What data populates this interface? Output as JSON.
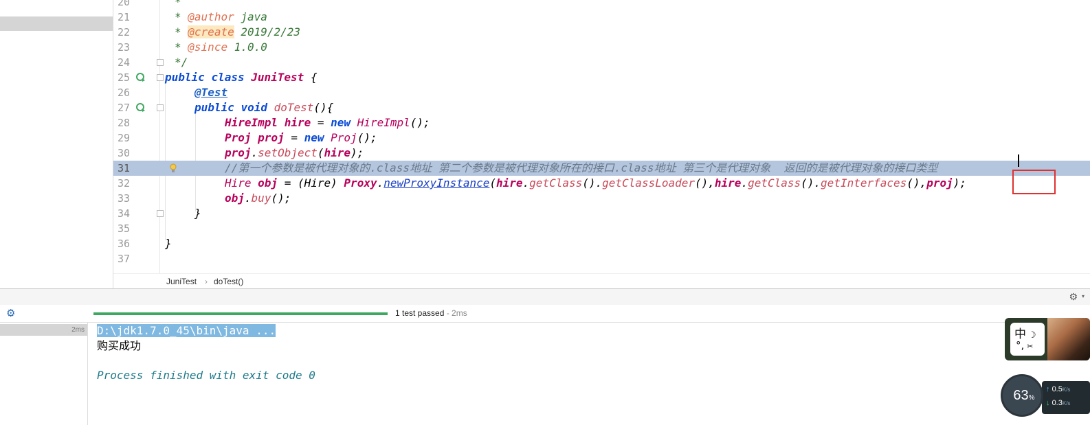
{
  "editor": {
    "lines": [
      {
        "num": "20"
      },
      {
        "num": "21"
      },
      {
        "num": "22"
      },
      {
        "num": "23"
      },
      {
        "num": "24"
      },
      {
        "num": "25"
      },
      {
        "num": "26"
      },
      {
        "num": "27"
      },
      {
        "num": "28"
      },
      {
        "num": "29"
      },
      {
        "num": "30"
      },
      {
        "num": "31"
      },
      {
        "num": "32"
      },
      {
        "num": "33"
      },
      {
        "num": "34"
      },
      {
        "num": "35"
      },
      {
        "num": "36"
      },
      {
        "num": "37"
      }
    ],
    "doc": {
      "star": "*",
      "author_tag": "@author",
      "author_val": " java",
      "create_tag": "@create",
      "create_val": " 2019/2/23",
      "since_tag": "@since",
      "since_val": " 1.0.0",
      "end": "*/"
    },
    "code": {
      "public": "public",
      "class": "class",
      "class_name": "JuniTest",
      "open_brace": " {",
      "test_ann": "@Test",
      "void": "void",
      "method_name": "doTest",
      "method_sig": "(){",
      "hire_type": "HireImpl",
      "hire_var": "hire",
      "eq": " = ",
      "new": "new",
      "hire_ctor": "HireImpl",
      "paren_end": "();",
      "proj_type": "Proj",
      "proj_var": "proj",
      "proj_ctor": "Proj",
      "set_object": "setObject",
      "set_args_open": "(",
      "set_args_close": ");",
      "comment": "//第一个参数是被代理对象的.class地址 第二个参数是被代理对象所在的接口.class地址 第三个是代理对象  返回的是被代理对象的接口类型",
      "hire_iface": "Hire",
      "obj_var": "obj",
      "cast": "(Hire)",
      "proxy": "Proxy",
      "dot": ".",
      "new_proxy": "newProxyInstance",
      "open_paren": "(",
      "get_class": "getClass",
      "get_loader": "getClassLoader",
      "get_ifaces": "getInterfaces",
      "call": "()",
      "comma": ",",
      "close_stmt": ");",
      "buy": "buy",
      "close_brace": "}"
    }
  },
  "breadcrumb": {
    "class": "JuniTest",
    "sep": "›",
    "method": "doTest()"
  },
  "run": {
    "status_main": "1 test passed",
    "status_dur": " - 2ms",
    "tree_time": "2ms",
    "progress": 1.0
  },
  "console": {
    "cmd": "D:\\jdk1.7.0_45\\bin\\java ...",
    "output": "购买成功",
    "finished": "Process finished with exit code 0"
  },
  "ime": {
    "char": "中",
    "moon": "☽",
    "punct": "°,",
    "butterfly": "✂"
  },
  "net": {
    "percent": "63",
    "percent_sign": "%",
    "up": "0.5",
    "up_unit": "K/s",
    "down": "0.3",
    "down_unit": "K/s",
    "up_arrow": "↑",
    "down_arrow": "↓"
  },
  "icons": {
    "settings": "⚙"
  },
  "colors": {
    "keyword": "#0a4bd6",
    "class": "#b8005a",
    "doc": "#3a7a3a",
    "highlight_line": "#b4c5de",
    "progress": "#3fa860",
    "red_box": "#e03030"
  }
}
